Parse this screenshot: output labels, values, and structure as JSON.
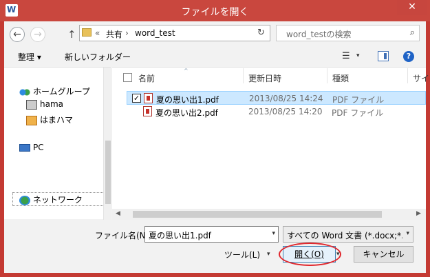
{
  "window": {
    "title": "ファイルを開く",
    "close_glyph": "✕"
  },
  "address": {
    "back_glyph": "←",
    "forward_glyph": "→",
    "up_glyph": "↑",
    "crumb_sep": "«",
    "crumbs": [
      "共有",
      "word_test"
    ],
    "crumb_arrow": "›",
    "refresh_glyph": "↻",
    "search_placeholder": "word_testの検索",
    "search_glyph": "⌕"
  },
  "toolbar": {
    "organize": "整理 ▾",
    "new_folder": "新しいフォルダー",
    "view_glyph": "☰",
    "view_arrow": "▾",
    "help_glyph": "?"
  },
  "nav": {
    "items": [
      {
        "label": "ホームグループ",
        "icon": "homegroup-icon"
      },
      {
        "label": "hama",
        "icon": "user-icon"
      },
      {
        "label": "はまハマ",
        "icon": "user-icon"
      },
      {
        "label": "PC",
        "icon": "computer-icon"
      },
      {
        "label": "ネットワーク",
        "icon": "network-icon"
      }
    ]
  },
  "files": {
    "columns": [
      "名前",
      "更新日時",
      "種類",
      "サイズ"
    ],
    "sort_glyph": "^",
    "rows": [
      {
        "name": "夏の思い出1.pdf",
        "date": "2013/08/25 14:24",
        "type": "PDF ファイル",
        "checked": true
      },
      {
        "name": "夏の思い出2.pdf",
        "date": "2013/08/25 14:20",
        "type": "PDF ファイル",
        "checked": false
      }
    ],
    "check_glyph": "✓",
    "scroll_left": "◀",
    "scroll_right": "▶"
  },
  "bottom": {
    "filename_label": "ファイル名(N):",
    "filename_value": "夏の思い出1.pdf",
    "filename_drop": "▾",
    "filter_value": "すべての Word 文書 (*.docx;*.",
    "filter_drop": "▾",
    "tools": "ツール(L)",
    "tools_arrow": "▾",
    "open": "開く(O)",
    "open_split": "▾",
    "cancel": "キャンセル"
  },
  "colors": {
    "titlebar": "#c9473e",
    "selection": "#cce8ff",
    "highlight_oval": "#e0262c"
  }
}
